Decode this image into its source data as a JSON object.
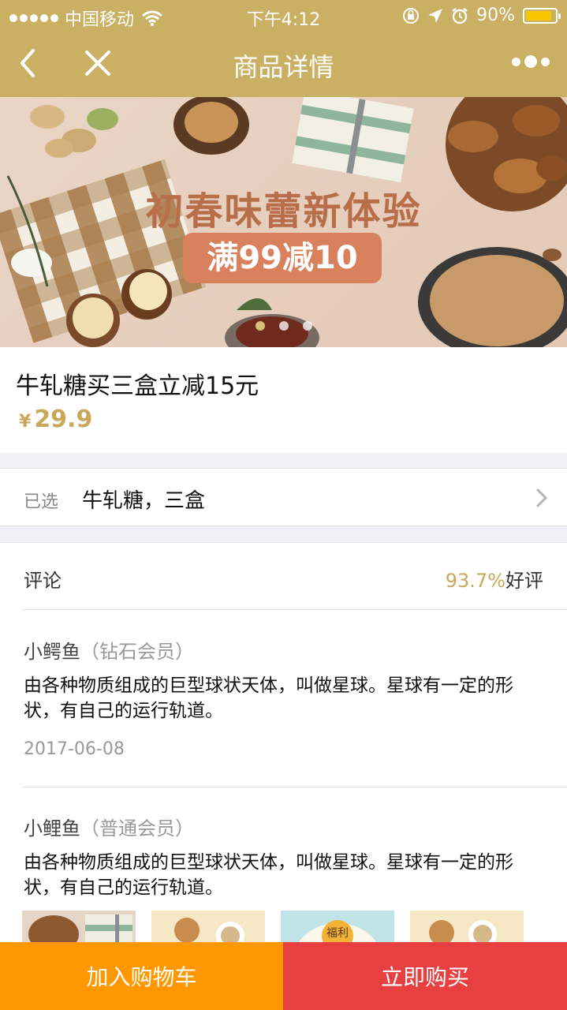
{
  "status_bar": {
    "carrier": "中国移动",
    "time": "下午4:12",
    "battery": "90%",
    "battery_level": 0.9
  },
  "nav": {
    "title": "商品详情",
    "icons": [
      "back-arrow-icon",
      "close-icon",
      "more-icon"
    ]
  },
  "banner": {
    "headline": "初春味蕾新体验",
    "promo": "满99减10",
    "slide_count": 3,
    "active_slide": 1
  },
  "product": {
    "title": "牛轧糖买三盒立减15元",
    "currency": "¥",
    "price": "29.9"
  },
  "selection": {
    "label": "已选",
    "value": "牛轧糖，三盒"
  },
  "reviews": {
    "title": "评论",
    "rating_pct": "93.7%",
    "rating_suffix": "好评",
    "items": [
      {
        "user": "小鳄鱼",
        "tier": "（钻石会员）",
        "content": "由各种物质组成的巨型球状天体，叫做星球。星球有一定的形状，有自己的运行轨道。",
        "date": "2017-06-08"
      },
      {
        "user": "小鲤鱼",
        "tier": "（普通会员）",
        "content": "由各种物质组成的巨型球状天体，叫做星球。星球有一定的形状，有自己的运行轨道。"
      }
    ],
    "thumb_label": "福利"
  },
  "actions": {
    "add_to_cart": "加入购物车",
    "buy_now": "立即购买"
  },
  "colors": {
    "header": "#c9b063",
    "price": "#c9a85c",
    "cart_button": "#ff9700",
    "buy_button": "#e84040"
  }
}
